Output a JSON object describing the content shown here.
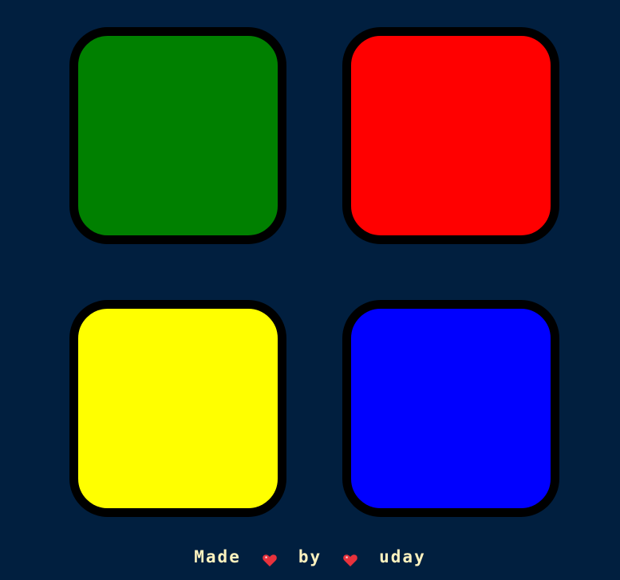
{
  "background_color": "#011f3f",
  "pads": [
    {
      "id": "green",
      "color": "#008000"
    },
    {
      "id": "red",
      "color": "#ff0000"
    },
    {
      "id": "yellow",
      "color": "#ffff00"
    },
    {
      "id": "blue",
      "color": "#0000ff"
    }
  ],
  "footer": {
    "made": "Made",
    "heart_icon": "heart-icon",
    "by": "by",
    "author": "uday",
    "text_color": "#fef2bf",
    "heart_color": "#e8323c"
  }
}
